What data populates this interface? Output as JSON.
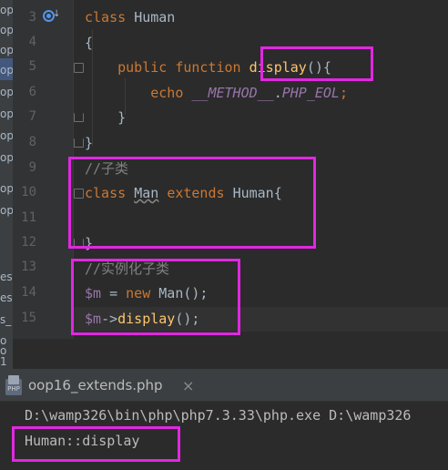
{
  "sidebar_fragments": [
    "op",
    "op",
    "op",
    "op",
    "op",
    "op",
    "op",
    "op",
    "op",
    "op",
    "es",
    "es",
    "s_",
    "o",
    "o",
    "1"
  ],
  "line_numbers": [
    "3",
    "4",
    "5",
    "6",
    "7",
    "8",
    "9",
    "10",
    "11",
    "12",
    "13",
    "14",
    "15"
  ],
  "code": {
    "l3": {
      "kw": "class",
      "name": "Human"
    },
    "l4": {
      "brace": "{"
    },
    "l5": {
      "public": "public",
      "function": "function",
      "method": "display",
      "rest": "(){"
    },
    "l6": {
      "echo": "echo",
      "magic": "__METHOD__",
      "dot": ".",
      "eol": "PHP_EOL",
      "semi": ";"
    },
    "l7": {
      "brace": "}"
    },
    "l8": {
      "brace": "}"
    },
    "l9": {
      "comment": "//子类"
    },
    "l10": {
      "kw": "class",
      "name": "Man",
      "extends": "extends",
      "parent": "Human",
      "brace": "{"
    },
    "l12": {
      "brace": "}"
    },
    "l13": {
      "comment": "//实例化子类"
    },
    "l14": {
      "var": "$m",
      "eq": " = ",
      "new": "new",
      "cls": "Man",
      "rest": "();"
    },
    "l15": {
      "var": "$m",
      "arrow": "->",
      "method": "display",
      "rest": "();"
    }
  },
  "run_tab": {
    "title": "oop16_extends.php",
    "close": "×",
    "icon_text": "PHP"
  },
  "console": {
    "command": "D:\\wamp326\\bin\\php\\php7.3.33\\php.exe D:\\wamp326",
    "output": "Human::display"
  },
  "colors": {
    "highlight": "#e028e0",
    "keyword": "#cc7832",
    "function": "#ffc66d",
    "variable": "#9876aa",
    "comment": "#808080",
    "text": "#a9b7c6"
  }
}
